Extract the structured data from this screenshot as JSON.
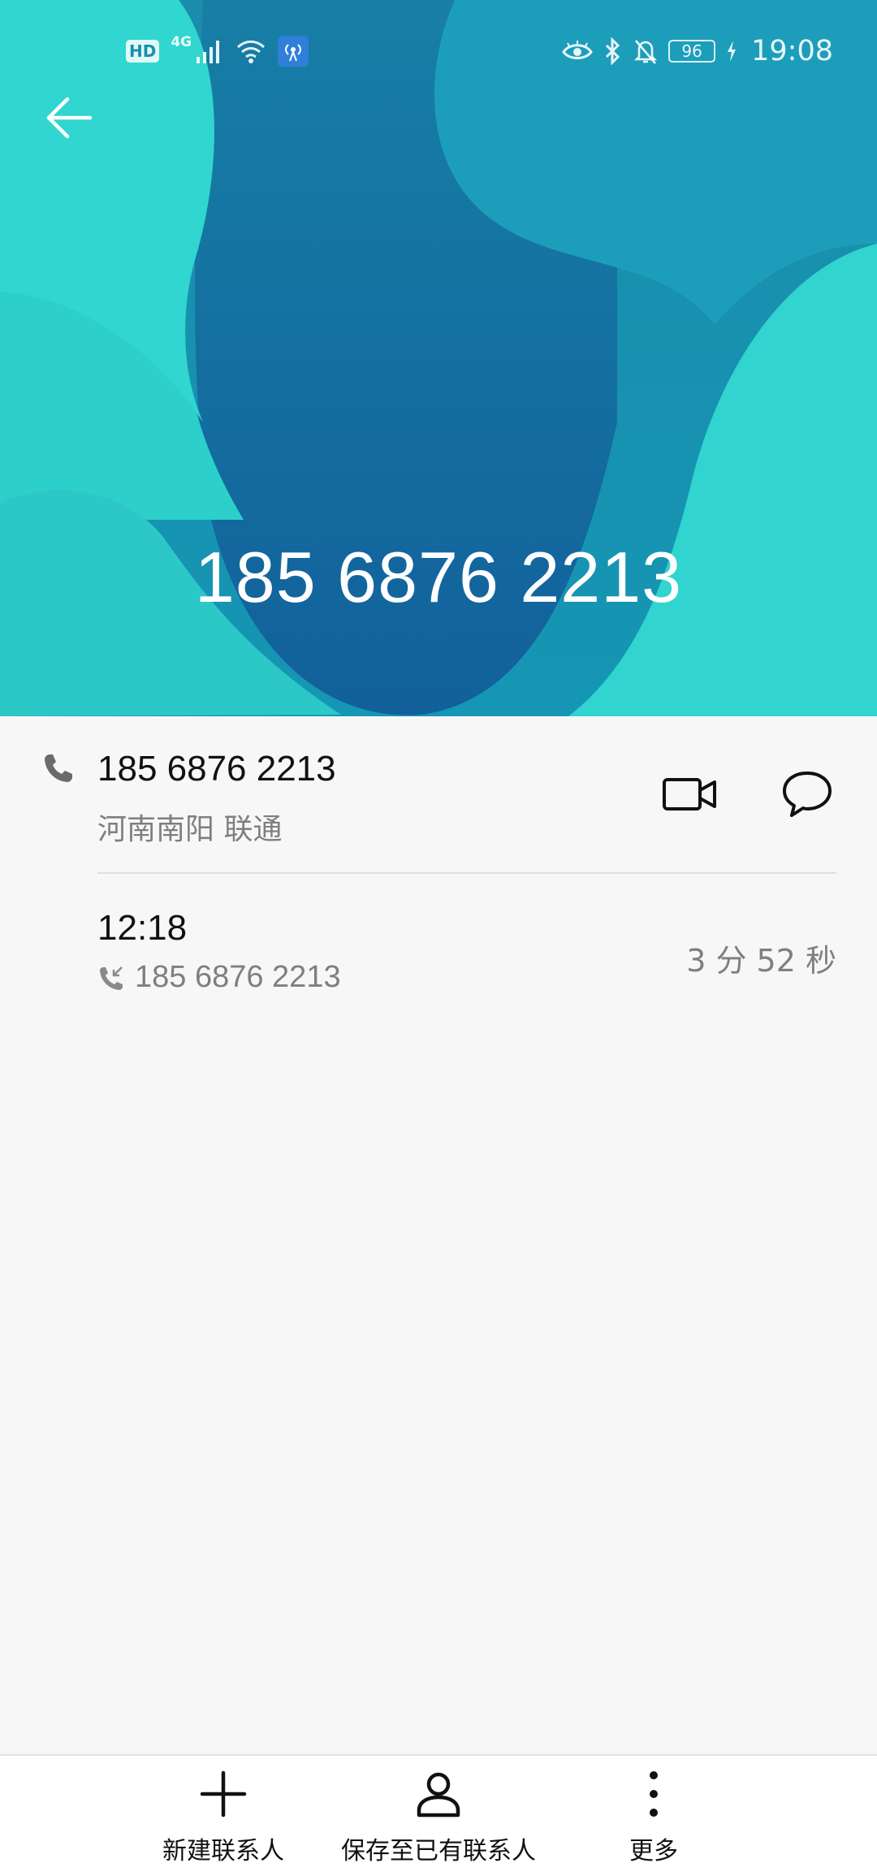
{
  "status_bar": {
    "network_type": "4G",
    "hd_label": "HD",
    "battery": "96",
    "time": "19:08"
  },
  "header": {
    "phone_number": "185 6876 2213",
    "colors": {
      "light": "#30d3cc",
      "mid": "#1b8eab",
      "dark": "#13609a"
    }
  },
  "contact": {
    "number": "185 6876 2213",
    "location": "河南南阳 联通"
  },
  "call_log": [
    {
      "time": "12:18",
      "number": "185 6876 2213",
      "duration": "3 分 52 秒",
      "type": "incoming"
    }
  ],
  "toolbar": {
    "new_contact_label": "新建联系人",
    "save_existing_label": "保存至已有联系人",
    "more_label": "更多"
  }
}
